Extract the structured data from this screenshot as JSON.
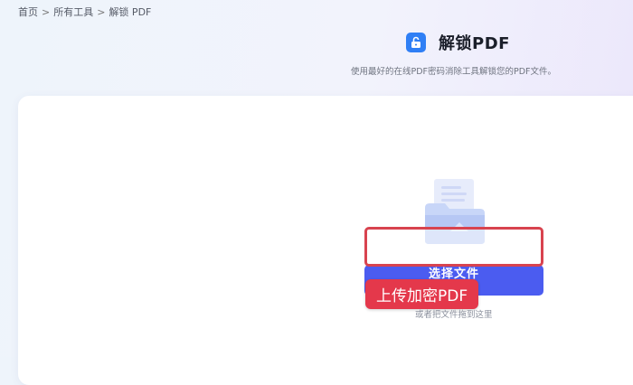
{
  "breadcrumb": {
    "home": "首页",
    "all_tools": "所有工具",
    "current": "解锁 PDF",
    "separator": ">"
  },
  "header": {
    "title": "解锁PDF",
    "subtitle": "使用最好的在线PDF密码消除工具解锁您的PDF文件。",
    "icon": "unlock-icon"
  },
  "upload": {
    "select_button_label": "选择文件",
    "drop_hint": "或者把文件拖到这里"
  },
  "annotation": {
    "callout_text": "上传加密PDF"
  },
  "colors": {
    "accent": "#4b5cf0",
    "highlight": "#d8434f",
    "callout": "#e4384b"
  }
}
